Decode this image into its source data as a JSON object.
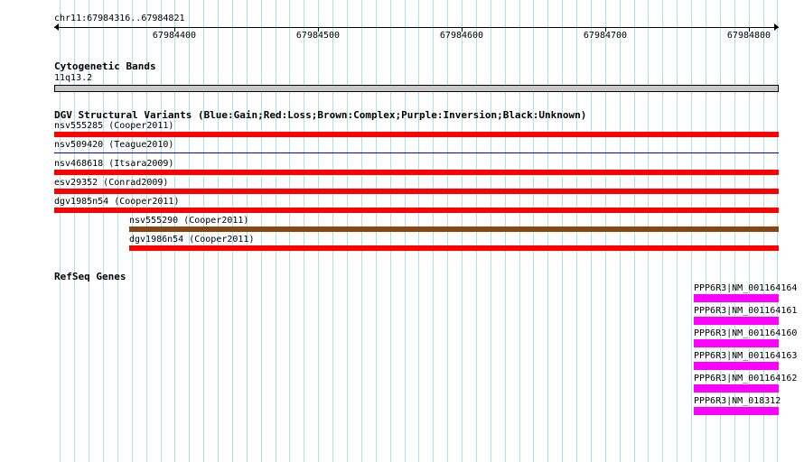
{
  "ruler": {
    "range_label": "chr11:67984316..67984821",
    "start": 67984316,
    "end": 67984821,
    "ticks": [
      {
        "pos": 67984400,
        "label": "67984400"
      },
      {
        "pos": 67984500,
        "label": "67984500"
      },
      {
        "pos": 67984600,
        "label": "67984600"
      },
      {
        "pos": 67984700,
        "label": "67984700"
      },
      {
        "pos": 67984800,
        "label": "67984800"
      }
    ]
  },
  "cytogenetic": {
    "title": "Cytogenetic Bands",
    "band_label": "11q13.2"
  },
  "dgv": {
    "title": "DGV Structural Variants (Blue:Gain;Red:Loss;Brown:Complex;Purple:Inversion;Black:Unknown)",
    "variants": [
      {
        "label": "nsv555285 (Cooper2011)",
        "type": "Loss",
        "start": 67984316,
        "end": 67984821
      },
      {
        "label": "nsv509420 (Teague2010)",
        "type": "Gain",
        "start": 67984316,
        "end": 67984821
      },
      {
        "label": "nsv468618 (Itsara2009)",
        "type": "Loss",
        "start": 67984316,
        "end": 67984821
      },
      {
        "label": "esv29352 (Conrad2009)",
        "type": "Loss",
        "start": 67984316,
        "end": 67984821
      },
      {
        "label": "dgv1985n54 (Cooper2011)",
        "type": "Loss",
        "start": 67984316,
        "end": 67984821
      },
      {
        "label": "nsv555290 (Cooper2011)",
        "type": "Complex",
        "start": 67984368,
        "end": 67984821
      },
      {
        "label": "dgv1986n54 (Cooper2011)",
        "type": "Loss",
        "start": 67984368,
        "end": 67984821
      }
    ],
    "colors": {
      "Gain": "#0000ff",
      "Loss": "#ff0000",
      "Complex": "#8b4513",
      "Inversion": "#800080",
      "Unknown": "#000000"
    }
  },
  "refseq": {
    "title": "RefSeq Genes",
    "color": "#ff00ff",
    "genes": [
      {
        "label": "PPP6R3|NM_001164164",
        "start": 67984762,
        "end": 67984821
      },
      {
        "label": "PPP6R3|NM_001164161",
        "start": 67984762,
        "end": 67984821
      },
      {
        "label": "PPP6R3|NM_001164160",
        "start": 67984762,
        "end": 67984821
      },
      {
        "label": "PPP6R3|NM_001164163",
        "start": 67984762,
        "end": 67984821
      },
      {
        "label": "PPP6R3|NM_001164162",
        "start": 67984762,
        "end": 67984821
      },
      {
        "label": "PPP6R3|NM_018312",
        "start": 67984762,
        "end": 67984821
      }
    ]
  }
}
